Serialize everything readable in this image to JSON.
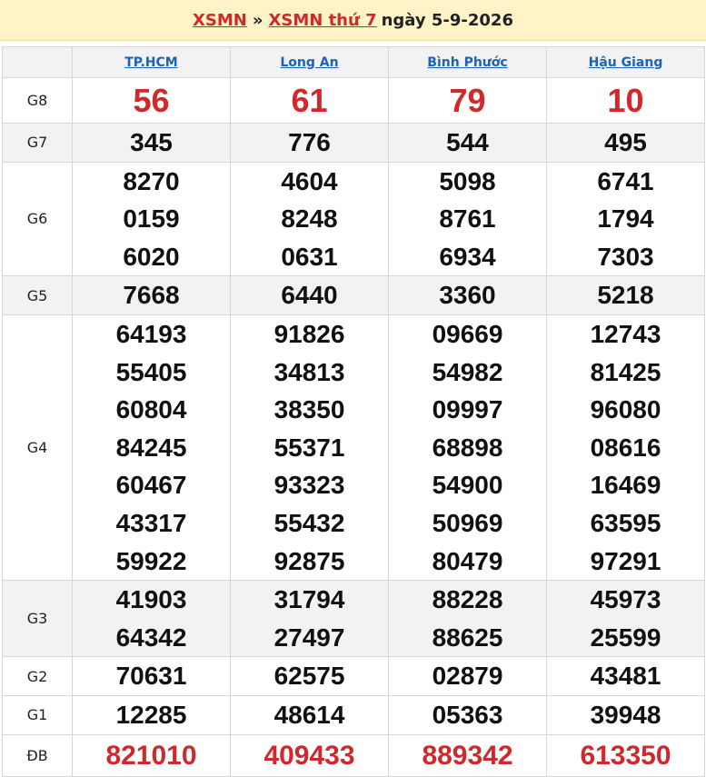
{
  "header": {
    "link1": "XSMN",
    "separator": "»",
    "link2": "XSMN thứ 7",
    "date": "ngày 5-9-2026"
  },
  "provinces": [
    "TP.HCM",
    "Long An",
    "Bình Phước",
    "Hậu Giang"
  ],
  "prizes": [
    {
      "label": "G8",
      "values": [
        [
          "56"
        ],
        [
          "61"
        ],
        [
          "79"
        ],
        [
          "10"
        ]
      ]
    },
    {
      "label": "G7",
      "values": [
        [
          "345"
        ],
        [
          "776"
        ],
        [
          "544"
        ],
        [
          "495"
        ]
      ]
    },
    {
      "label": "G6",
      "values": [
        [
          "8270",
          "0159",
          "6020"
        ],
        [
          "4604",
          "8248",
          "0631"
        ],
        [
          "5098",
          "8761",
          "6934"
        ],
        [
          "6741",
          "1794",
          "7303"
        ]
      ]
    },
    {
      "label": "G5",
      "values": [
        [
          "7668"
        ],
        [
          "6440"
        ],
        [
          "3360"
        ],
        [
          "5218"
        ]
      ]
    },
    {
      "label": "G4",
      "values": [
        [
          "64193",
          "55405",
          "60804",
          "84245",
          "60467",
          "43317",
          "59922"
        ],
        [
          "91826",
          "34813",
          "38350",
          "55371",
          "93323",
          "55432",
          "92875"
        ],
        [
          "09669",
          "54982",
          "09997",
          "68898",
          "54900",
          "50969",
          "80479"
        ],
        [
          "12743",
          "81425",
          "96080",
          "08616",
          "16469",
          "63595",
          "97291"
        ]
      ]
    },
    {
      "label": "G3",
      "values": [
        [
          "41903",
          "64342"
        ],
        [
          "31794",
          "27497"
        ],
        [
          "88228",
          "88625"
        ],
        [
          "45973",
          "25599"
        ]
      ]
    },
    {
      "label": "G2",
      "values": [
        [
          "70631"
        ],
        [
          "62575"
        ],
        [
          "02879"
        ],
        [
          "43481"
        ]
      ]
    },
    {
      "label": "G1",
      "values": [
        [
          "12285"
        ],
        [
          "48614"
        ],
        [
          "05363"
        ],
        [
          "39948"
        ]
      ]
    },
    {
      "label": "ĐB",
      "values": [
        [
          "821010"
        ],
        [
          "409433"
        ],
        [
          "889342"
        ],
        [
          "613350"
        ]
      ]
    }
  ]
}
